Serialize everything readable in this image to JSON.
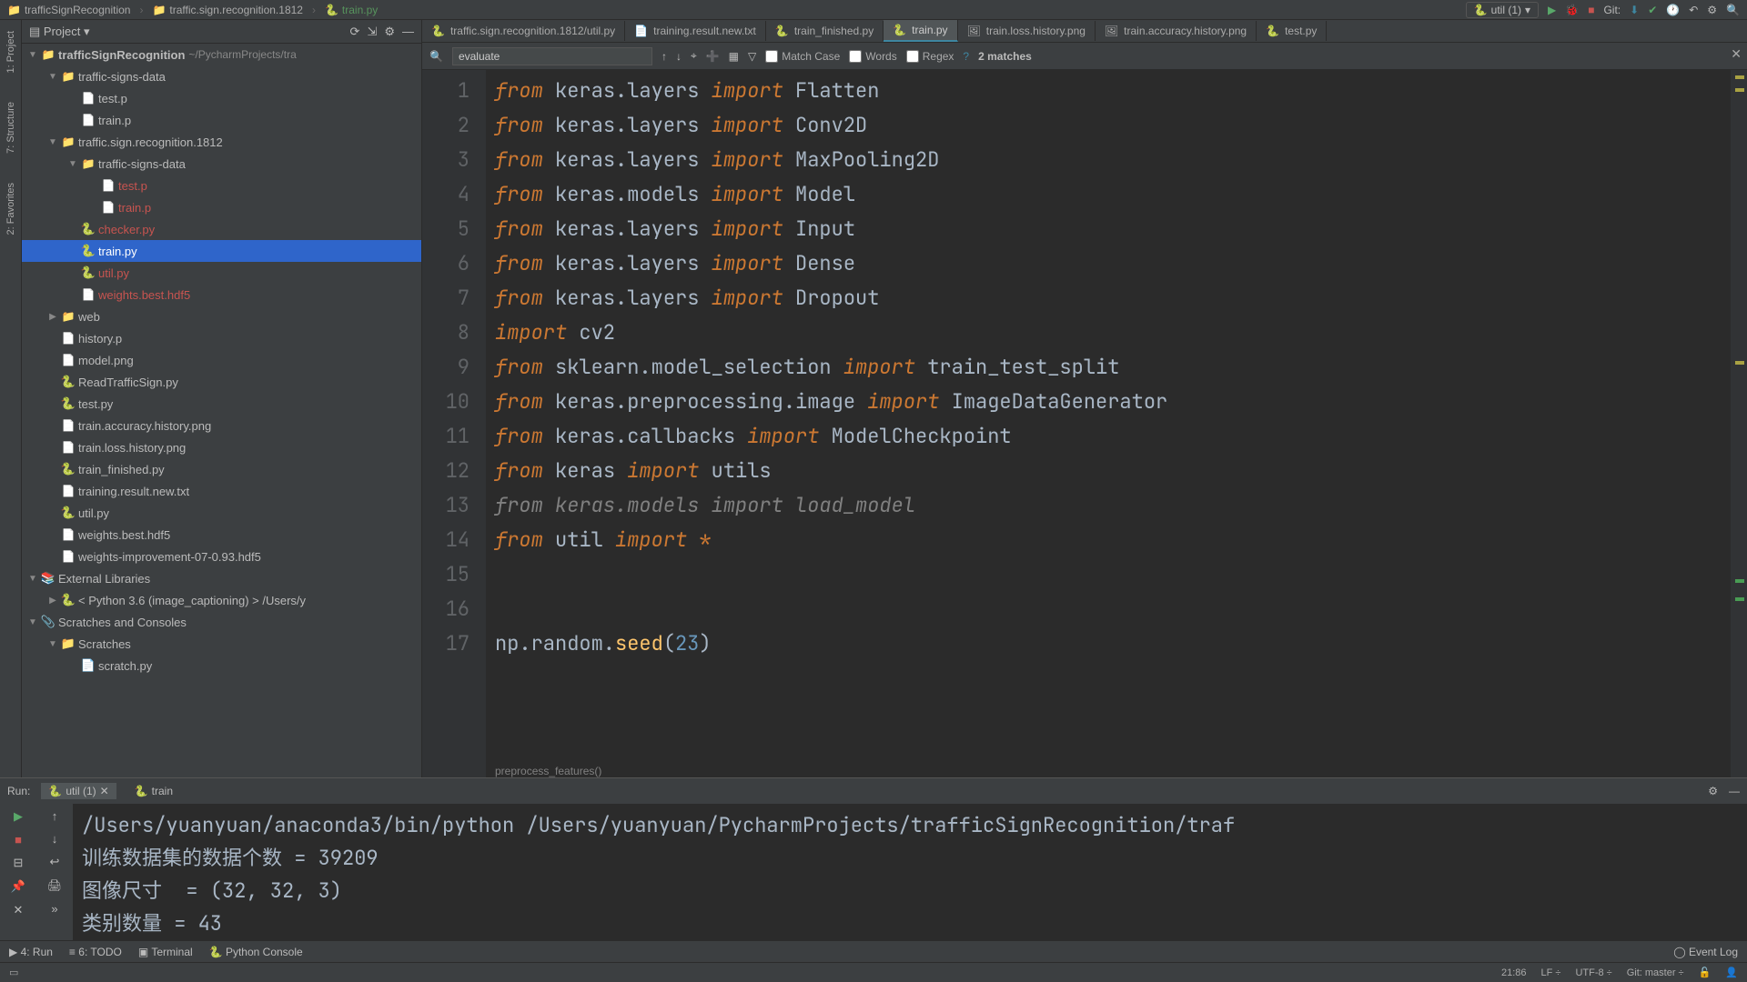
{
  "breadcrumb": {
    "root": "trafficSignRecognition",
    "mid": "traffic.sign.recognition.1812",
    "file": "train.py"
  },
  "topright": {
    "config": "util (1)",
    "git_label": "Git:"
  },
  "project": {
    "title": "Project"
  },
  "tree": {
    "root": "trafficSignRecognition",
    "root_path": "~/PycharmProjects/tra",
    "items": [
      {
        "indent": 1,
        "arrow": "▼",
        "icon": "folder",
        "label": "traffic-signs-data"
      },
      {
        "indent": 2,
        "arrow": "",
        "icon": "file",
        "label": "test.p"
      },
      {
        "indent": 2,
        "arrow": "",
        "icon": "file",
        "label": "train.p"
      },
      {
        "indent": 1,
        "arrow": "▼",
        "icon": "folder",
        "label": "traffic.sign.recognition.1812"
      },
      {
        "indent": 2,
        "arrow": "▼",
        "icon": "folder",
        "label": "traffic-signs-data"
      },
      {
        "indent": 3,
        "arrow": "",
        "icon": "file",
        "label": "test.p",
        "red": true
      },
      {
        "indent": 3,
        "arrow": "",
        "icon": "file",
        "label": "train.p",
        "red": true
      },
      {
        "indent": 2,
        "arrow": "",
        "icon": "py",
        "label": "checker.py",
        "red": true
      },
      {
        "indent": 2,
        "arrow": "",
        "icon": "py",
        "label": "train.py",
        "selected": true
      },
      {
        "indent": 2,
        "arrow": "",
        "icon": "py",
        "label": "util.py",
        "red": true
      },
      {
        "indent": 2,
        "arrow": "",
        "icon": "file",
        "label": "weights.best.hdf5",
        "red": true
      },
      {
        "indent": 1,
        "arrow": "▶",
        "icon": "folder",
        "label": "web"
      },
      {
        "indent": 1,
        "arrow": "",
        "icon": "file",
        "label": "history.p"
      },
      {
        "indent": 1,
        "arrow": "",
        "icon": "file",
        "label": "model.png"
      },
      {
        "indent": 1,
        "arrow": "",
        "icon": "py",
        "label": "ReadTrafficSign.py"
      },
      {
        "indent": 1,
        "arrow": "",
        "icon": "py",
        "label": "test.py"
      },
      {
        "indent": 1,
        "arrow": "",
        "icon": "file",
        "label": "train.accuracy.history.png"
      },
      {
        "indent": 1,
        "arrow": "",
        "icon": "file",
        "label": "train.loss.history.png"
      },
      {
        "indent": 1,
        "arrow": "",
        "icon": "py",
        "label": "train_finished.py"
      },
      {
        "indent": 1,
        "arrow": "",
        "icon": "file",
        "label": "training.result.new.txt"
      },
      {
        "indent": 1,
        "arrow": "",
        "icon": "py",
        "label": "util.py"
      },
      {
        "indent": 1,
        "arrow": "",
        "icon": "file",
        "label": "weights.best.hdf5"
      },
      {
        "indent": 1,
        "arrow": "",
        "icon": "file",
        "label": "weights-improvement-07-0.93.hdf5"
      }
    ],
    "ext_libs": "External Libraries",
    "python_env": "< Python 3.6 (image_captioning) >",
    "python_env_path": "/Users/y",
    "scratches": "Scratches and Consoles",
    "scratches_sub": "Scratches",
    "scratch_file": "scratch.py"
  },
  "tabs": [
    {
      "label": "traffic.sign.recognition.1812/util.py",
      "icon": "py"
    },
    {
      "label": "training.result.new.txt",
      "icon": "txt"
    },
    {
      "label": "train_finished.py",
      "icon": "py"
    },
    {
      "label": "train.py",
      "icon": "py",
      "active": true
    },
    {
      "label": "train.loss.history.png",
      "icon": "img"
    },
    {
      "label": "train.accuracy.history.png",
      "icon": "img"
    },
    {
      "label": "test.py",
      "icon": "py"
    }
  ],
  "search": {
    "value": "evaluate",
    "match_case": "Match Case",
    "words": "Words",
    "regex": "Regex",
    "matches": "2 matches"
  },
  "code": {
    "lines": [
      {
        "n": 1,
        "tokens": [
          {
            "t": "from ",
            "c": "kw-from"
          },
          {
            "t": "keras.layers ",
            "c": "mod"
          },
          {
            "t": "import ",
            "c": "kw-import"
          },
          {
            "t": "Flatten",
            "c": "mod"
          }
        ]
      },
      {
        "n": 2,
        "tokens": [
          {
            "t": "from ",
            "c": "kw-from"
          },
          {
            "t": "keras.layers ",
            "c": "mod"
          },
          {
            "t": "import ",
            "c": "kw-import"
          },
          {
            "t": "Conv2D",
            "c": "mod"
          }
        ]
      },
      {
        "n": 3,
        "tokens": [
          {
            "t": "from ",
            "c": "kw-from"
          },
          {
            "t": "keras.layers ",
            "c": "mod"
          },
          {
            "t": "import ",
            "c": "kw-import"
          },
          {
            "t": "MaxPooling2D",
            "c": "mod"
          }
        ]
      },
      {
        "n": 4,
        "tokens": [
          {
            "t": "from ",
            "c": "kw-from"
          },
          {
            "t": "keras.models ",
            "c": "mod"
          },
          {
            "t": "import ",
            "c": "kw-import"
          },
          {
            "t": "Model",
            "c": "mod"
          }
        ]
      },
      {
        "n": 5,
        "tokens": [
          {
            "t": "from ",
            "c": "kw-from"
          },
          {
            "t": "keras.layers ",
            "c": "mod"
          },
          {
            "t": "import ",
            "c": "kw-import"
          },
          {
            "t": "Input",
            "c": "mod"
          }
        ]
      },
      {
        "n": 6,
        "tokens": [
          {
            "t": "from ",
            "c": "kw-from"
          },
          {
            "t": "keras.layers ",
            "c": "mod"
          },
          {
            "t": "import ",
            "c": "kw-import"
          },
          {
            "t": "Dense",
            "c": "mod"
          }
        ]
      },
      {
        "n": 7,
        "tokens": [
          {
            "t": "from ",
            "c": "kw-from"
          },
          {
            "t": "keras.layers ",
            "c": "mod"
          },
          {
            "t": "import ",
            "c": "kw-import"
          },
          {
            "t": "Dropout",
            "c": "mod"
          }
        ]
      },
      {
        "n": 8,
        "tokens": [
          {
            "t": "import ",
            "c": "kw-import"
          },
          {
            "t": "cv2",
            "c": "mod"
          }
        ]
      },
      {
        "n": 9,
        "tokens": [
          {
            "t": "from ",
            "c": "kw-from"
          },
          {
            "t": "sklearn.model_selection ",
            "c": "mod"
          },
          {
            "t": "import ",
            "c": "kw-import"
          },
          {
            "t": "train_test_split",
            "c": "mod"
          }
        ]
      },
      {
        "n": 10,
        "tokens": [
          {
            "t": "from ",
            "c": "kw-from"
          },
          {
            "t": "keras.preprocessing.image ",
            "c": "mod"
          },
          {
            "t": "import ",
            "c": "kw-import"
          },
          {
            "t": "ImageDataGenerator",
            "c": "mod"
          }
        ]
      },
      {
        "n": 11,
        "tokens": [
          {
            "t": "from ",
            "c": "kw-from"
          },
          {
            "t": "keras.callbacks ",
            "c": "mod"
          },
          {
            "t": "import ",
            "c": "kw-import"
          },
          {
            "t": "ModelCheckpoint",
            "c": "mod"
          }
        ]
      },
      {
        "n": 12,
        "tokens": [
          {
            "t": "from ",
            "c": "kw-from"
          },
          {
            "t": "keras ",
            "c": "mod"
          },
          {
            "t": "import ",
            "c": "kw-import"
          },
          {
            "t": "utils",
            "c": "mod"
          }
        ]
      },
      {
        "n": 13,
        "tokens": [
          {
            "t": "from ",
            "c": "unused"
          },
          {
            "t": "keras.models ",
            "c": "unused"
          },
          {
            "t": "import ",
            "c": "unused"
          },
          {
            "t": "load_model",
            "c": "unused"
          }
        ]
      },
      {
        "n": 14,
        "tokens": [
          {
            "t": "from ",
            "c": "kw-from"
          },
          {
            "t": "util ",
            "c": "mod"
          },
          {
            "t": "import ",
            "c": "kw-import"
          },
          {
            "t": "*",
            "c": "star"
          }
        ]
      },
      {
        "n": 15,
        "tokens": []
      },
      {
        "n": 16,
        "tokens": []
      },
      {
        "n": 17,
        "tokens": [
          {
            "t": "np.random.",
            "c": "mod"
          },
          {
            "t": "seed",
            "c": "fn"
          },
          {
            "t": "(",
            "c": "mod"
          },
          {
            "t": "23",
            "c": "num"
          },
          {
            "t": ")",
            "c": "mod"
          }
        ]
      }
    ],
    "hint": "preprocess_features()"
  },
  "run": {
    "label": "Run:",
    "tabs": [
      {
        "label": "util (1)",
        "active": true
      },
      {
        "label": "train"
      }
    ],
    "console_lines": [
      "/Users/yuanyuan/anaconda3/bin/python /Users/yuanyuan/PycharmProjects/trafficSignRecognition/traf",
      "训练数据集的数据个数 = 39209",
      "图像尺寸  = (32, 32, 3)",
      "类别数量 = 43"
    ]
  },
  "bottombar": {
    "run": "4: Run",
    "todo": "6: TODO",
    "terminal": "Terminal",
    "pyconsole": "Python Console",
    "eventlog": "Event Log"
  },
  "status": {
    "pos": "21:86",
    "sep": "LF",
    "enc": "UTF-8",
    "git": "Git: master"
  },
  "left_gutter": {
    "project": "1: Project",
    "favorites": "2: Favorites",
    "structure": "7: Structure"
  }
}
